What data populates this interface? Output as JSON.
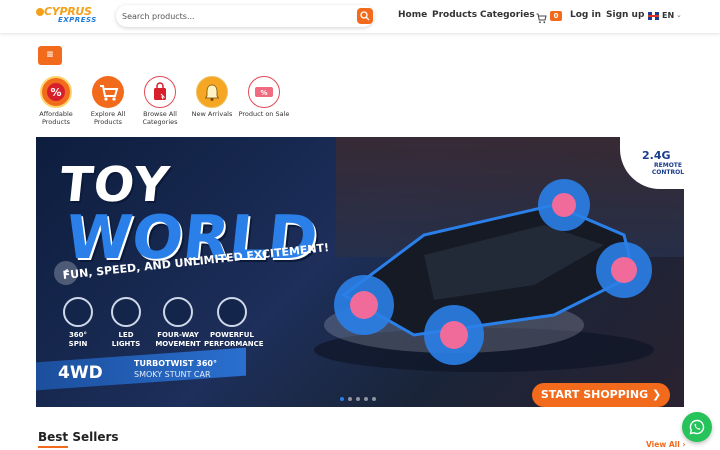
{
  "header": {
    "logo_top": "CYPRUS",
    "logo_bottom": "EXPRESS",
    "search_placeholder": "Search products...",
    "nav": [
      "Home",
      "Products",
      "Categories"
    ],
    "cart_count": "0",
    "login": "Log in",
    "signup": "Sign up",
    "language": "EN"
  },
  "menu_button": "≡",
  "categories": [
    {
      "label": "Affordable Products",
      "icon": "percent-icon"
    },
    {
      "label": "Explore All Products",
      "icon": "cart-icon"
    },
    {
      "label": "Browse All Categories",
      "icon": "shopping-bag-icon"
    },
    {
      "label": "New Arrivals",
      "icon": "bell-icon"
    },
    {
      "label": "Product on Sale",
      "icon": "sale-tag-icon"
    }
  ],
  "banner": {
    "title_1": "TOY",
    "title_2": "WORLD",
    "subtitle": "FUN, SPEED, AND UNLIMITED EXCITEMENT!",
    "features": [
      {
        "label_1": "360°",
        "label_2": "SPIN"
      },
      {
        "label_1": "LED",
        "label_2": "LIGHTS"
      },
      {
        "label_1": "FOUR-WAY",
        "label_2": "MOVEMENT"
      },
      {
        "label_1": "POWERFUL",
        "label_2": "PERFORMANCE"
      }
    ],
    "badge_4wd": "4WD",
    "product_line_1": "TURBOTWIST 360°",
    "product_line_2": "SMOKY STUNT CAR",
    "remote_1": "2.4G",
    "remote_2": "REMOTE CONTROL",
    "cta": "START SHOPPING ❯",
    "prev": "‹",
    "slide_count": 5,
    "active_slide": 0
  },
  "best_sellers": {
    "title": "Best Sellers",
    "view_all": "View All ›"
  },
  "colors": {
    "accent": "#f26a1b",
    "brand_blue": "#2a7fe8",
    "whatsapp": "#25c35a"
  }
}
